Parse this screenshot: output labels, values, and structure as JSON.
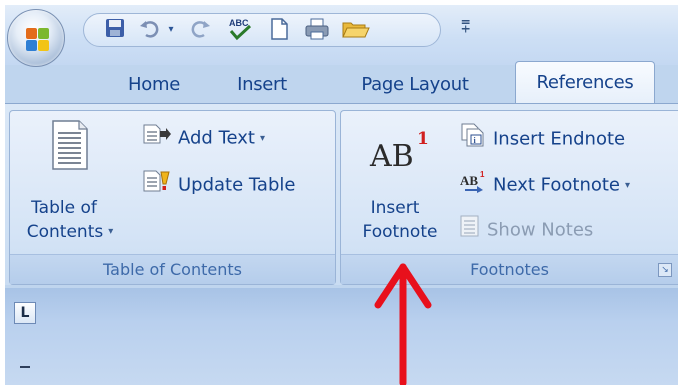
{
  "ribbon_tabs": [
    {
      "label": "Home"
    },
    {
      "label": "Insert"
    },
    {
      "label": "Page Layout"
    },
    {
      "label": "References",
      "active": true
    }
  ],
  "toc_group": {
    "table_of_contents_label_line1": "Table of",
    "table_of_contents_label_line2": "Contents",
    "add_text_label": "Add Text",
    "update_table_label": "Update Table",
    "group_label": "Table of Contents"
  },
  "footnotes_group": {
    "ab_glyph": "AB",
    "ab_superscript": "1",
    "insert_footnote_line1": "Insert",
    "insert_footnote_line2": "Footnote",
    "insert_endnote_label": "Insert Endnote",
    "next_footnote_label": "Next Footnote",
    "show_notes_label": "Show Notes",
    "group_label": "Footnotes"
  },
  "tab_selector_glyph": "L",
  "qat_icons": [
    "save-icon",
    "undo-icon",
    "redo-icon",
    "spelling-icon",
    "new-document-icon",
    "print-icon",
    "open-folder-icon"
  ],
  "annotation": {
    "arrow_color": "#e8101c"
  }
}
